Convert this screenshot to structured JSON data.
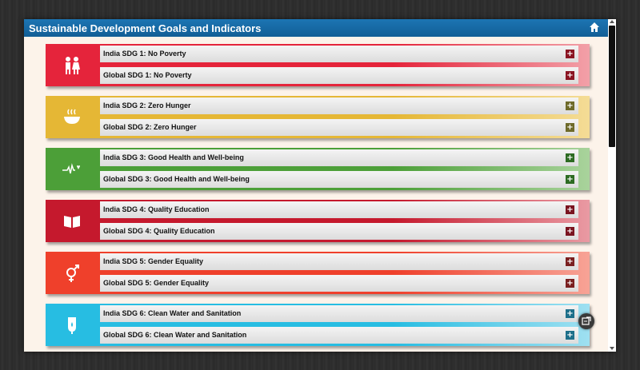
{
  "window": {
    "title": "Sustainable Development Goals and Indicators"
  },
  "icons": {
    "home": "home-icon",
    "chat": "chat-icon"
  },
  "goals": [
    {
      "india_label": "India SDG 1: No Poverty",
      "global_label": "Global SDG 1: No Poverty",
      "color": "#e5243b",
      "icon": "family-icon"
    },
    {
      "india_label": "India SDG 2: Zero Hunger",
      "global_label": "Global SDG 2: Zero Hunger",
      "color": "#e5b735",
      "icon": "bowl-icon"
    },
    {
      "india_label": "India SDG 3: Good Health and Well-being",
      "global_label": "Global SDG 3: Good Health and Well-being",
      "color": "#4c9f38",
      "icon": "heartbeat-icon"
    },
    {
      "india_label": "India SDG 4: Quality Education",
      "global_label": "Global SDG 4: Quality Education",
      "color": "#c5192d",
      "icon": "book-icon"
    },
    {
      "india_label": "India SDG 5: Gender Equality",
      "global_label": "Global SDG 5: Gender Equality",
      "color": "#ef402b",
      "icon": "gender-icon"
    },
    {
      "india_label": "India SDG 6: Clean Water and Sanitation",
      "global_label": "Global SDG 6: Clean Water and Sanitation",
      "color": "#27bde2",
      "icon": "water-drop-icon"
    }
  ],
  "expand_symbol": "+"
}
